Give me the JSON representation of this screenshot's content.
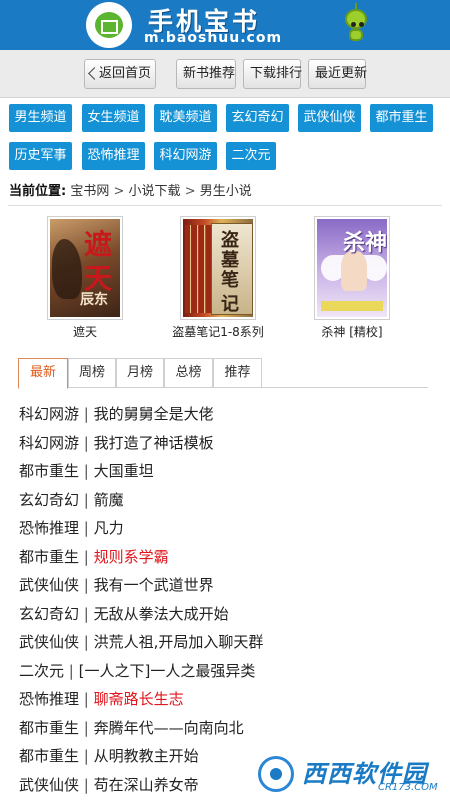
{
  "header": {
    "site_title": "手机宝书",
    "site_url": "m.baoshuu.com"
  },
  "nav": {
    "back": "返回首页",
    "new_books": "新书推荐",
    "download_rank": "下载排行",
    "latest_update": "最近更新"
  },
  "categories": [
    "男生频道",
    "女生频道",
    "耽美频道",
    "玄幻奇幻",
    "武侠仙侠",
    "都市重生",
    "历史军事",
    "恐怖推理",
    "科幻网游",
    "二次元"
  ],
  "breadcrumb": {
    "label": "当前位置:",
    "items": [
      "宝书网",
      "小说下载",
      "男生小说"
    ],
    "separator": ">"
  },
  "featured": [
    {
      "title": "遮天",
      "cover_text": [
        "遮",
        "天"
      ],
      "cover_author": "辰东",
      "cover_icon": "zhetian-cover"
    },
    {
      "title": "盗墓笔记1-8系列",
      "cover_text": [
        "盗",
        "墓",
        "笔",
        "记"
      ],
      "cover_icon": "daomu-cover"
    },
    {
      "title": "杀神 [精校]",
      "cover_text": [
        "杀神"
      ],
      "cover_icon": "shashen-cover"
    }
  ],
  "tabs": [
    "最新",
    "周榜",
    "月榜",
    "总榜",
    "推荐"
  ],
  "active_tab": "最新",
  "list": [
    {
      "category": "科幻网游",
      "title": "我的舅舅全是大佬",
      "hot": false
    },
    {
      "category": "科幻网游",
      "title": "我打造了神话模板",
      "hot": false
    },
    {
      "category": "都市重生",
      "title": "大国重坦",
      "hot": false
    },
    {
      "category": "玄幻奇幻",
      "title": "箭魔",
      "hot": false
    },
    {
      "category": "恐怖推理",
      "title": "凡力",
      "hot": false
    },
    {
      "category": "都市重生",
      "title": "规则系学霸",
      "hot": true
    },
    {
      "category": "武侠仙侠",
      "title": "我有一个武道世界",
      "hot": false
    },
    {
      "category": "玄幻奇幻",
      "title": "无敌从拳法大成开始",
      "hot": false
    },
    {
      "category": "武侠仙侠",
      "title": "洪荒人祖,开局加入聊天群",
      "hot": false
    },
    {
      "category": "二次元",
      "title": "[一人之下]一人之最强异类",
      "hot": false
    },
    {
      "category": "恐怖推理",
      "title": "聊斋路长生志",
      "hot": true
    },
    {
      "category": "都市重生",
      "title": "奔腾年代——向南向北",
      "hot": false
    },
    {
      "category": "都市重生",
      "title": "从明教教主开始",
      "hot": false
    },
    {
      "category": "武侠仙侠",
      "title": "苟在深山养女帝",
      "hot": false
    }
  ],
  "watermark": {
    "text": "西西软件园",
    "url": "CR173.COM"
  },
  "colors": {
    "header_bg": "#1a7bc4",
    "category_bg": "#1592d6",
    "active_tab": "#e05a1a",
    "hot_title": "#e0161c"
  }
}
